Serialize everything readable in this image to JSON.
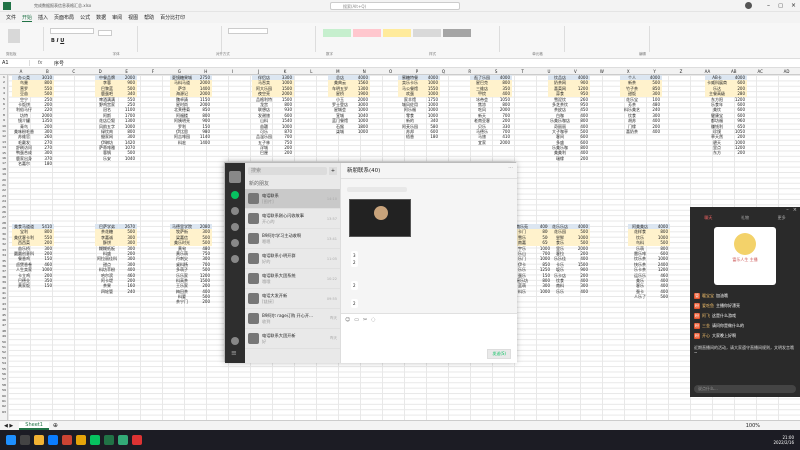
{
  "window": {
    "title": "完成数据报表信息表格汇总.xlsx",
    "search": "搜索(Alt+Q)"
  },
  "menu": [
    "文件",
    "开始",
    "插入",
    "页面布局",
    "公式",
    "数据",
    "审阅",
    "视图",
    "帮助",
    "百分比打印"
  ],
  "ribbon": {
    "groups": [
      "剪贴板",
      "字体",
      "对齐方式",
      "数字",
      "样式",
      "单元格",
      "编辑"
    ]
  },
  "formula": {
    "namebox": "A1",
    "fx": "fx",
    "content": "序号"
  },
  "columns": [
    "A",
    "B",
    "C",
    "D",
    "E",
    "F",
    "G",
    "H",
    "I",
    "J",
    "K",
    "L",
    "M",
    "N",
    "O",
    "P",
    "Q",
    "R",
    "S",
    "T",
    "U",
    "V",
    "W",
    "X",
    "Y",
    "Z",
    "AA",
    "AB",
    "AC",
    "AD"
  ],
  "tables_top": [
    {
      "title": "办公类",
      "total": "3010",
      "rows": [
        [
          "鸟巢",
          "800"
        ],
        [
          "营罗",
          "550"
        ],
        [
          "豆苗",
          "500"
        ],
        [
          "空宁",
          "250"
        ],
        [
          "卡饭饼",
          "200"
        ],
        [
          "利俗马仔",
          "220"
        ],
        [
          "坊特",
          "2000"
        ],
        [
          "镜介罐",
          "1350"
        ],
        [
          "青鸟",
          "200"
        ],
        [
          "美味粉毛香",
          "300"
        ],
        [
          "苏维官",
          "260"
        ],
        [
          "毛戴发",
          "270"
        ],
        [
          "舒刷访问",
          "270"
        ],
        [
          "鸭蛋合成",
          "300"
        ],
        [
          "鹿家出身",
          "370"
        ],
        [
          "名嘉尔",
          "180"
        ]
      ]
    },
    {
      "title": "中餐品牌",
      "total": "2000",
      "rows": [
        [
          "李蓉",
          "900"
        ],
        [
          "巴黎蓝",
          "500"
        ],
        [
          "鹿蛋吧",
          "340"
        ],
        [
          "啤酒满满",
          "550"
        ],
        [
          "野鸡宫家",
          "250"
        ],
        [
          "冠名",
          "1100"
        ],
        [
          "阿斯",
          "1700"
        ],
        [
          "花店巨叙",
          "1300"
        ],
        [
          "风韵五字",
          "1000"
        ],
        [
          "绿饮肉",
          "800"
        ],
        [
          "摄家网",
          "300"
        ],
        [
          "伊琳坊",
          "1420"
        ],
        [
          "萨蒂啡雅",
          "1070"
        ],
        [
          "蓉锅",
          "500"
        ],
        [
          "乐安",
          "1040"
        ]
      ]
    },
    {
      "title": "夏镜糖果城",
      "total": "2750",
      "rows": [
        [
          "马料马道",
          "2000"
        ],
        [
          "萨华",
          "1400"
        ],
        [
          "海源记",
          "2000"
        ],
        [
          "魏卓清",
          "1150"
        ],
        [
          "星时尚",
          "2000"
        ],
        [
          "北莱德菊",
          "850"
        ],
        [
          "阿福楼",
          "800"
        ],
        [
          "阿姨明亮",
          "900"
        ],
        [
          "罗利",
          "150"
        ],
        [
          "伊比思",
          "980"
        ],
        [
          "阿吉啡园",
          "1140"
        ],
        [
          "料宏",
          "1400"
        ]
      ]
    },
    {
      "title": "伴侣店",
      "total": "3300",
      "rows": [
        [
          "马吞卖",
          "1000"
        ],
        [
          "阿大乐园",
          "1500"
        ],
        [
          "夜空亮",
          "2000"
        ],
        [
          "品格利特",
          "1500"
        ],
        [
          "龙宫",
          "800"
        ],
        [
          "联想店",
          "930"
        ],
        [
          "发谢旅",
          "600"
        ],
        [
          "山料",
          "1540"
        ],
        [
          "苗疆",
          "1000"
        ],
        [
          "可乐",
          "870"
        ],
        [
          "品温乐园",
          "700"
        ],
        [
          "五子林",
          "750"
        ],
        [
          "浮城",
          "200"
        ],
        [
          "巴厘",
          "200"
        ]
      ]
    },
    {
      "title": "总店",
      "total": "4000",
      "rows": [
        [
          "美典云",
          "1560"
        ],
        [
          "车明五岁",
          "1300"
        ],
        [
          "星桥",
          "1900"
        ],
        [
          "小玉",
          "2000"
        ],
        [
          "罗士登店",
          "3000"
        ],
        [
          "星城会",
          "1000"
        ],
        [
          "宣城",
          "1040"
        ],
        [
          "蓝门餐馆",
          "1000"
        ],
        [
          "石猴",
          "1800"
        ],
        [
          "柒城",
          "1000"
        ]
      ]
    },
    {
      "title": "蜜糖特餐",
      "total": "4000",
      "rows": [
        [
          "卖乐卡乐",
          "1000"
        ],
        [
          "马公餐馆",
          "1550"
        ],
        [
          "欢蛋",
          "1000"
        ],
        [
          "家羊馆",
          "1750"
        ],
        [
          "城风佐用",
          "1000"
        ],
        [
          "阿乐福",
          "1000"
        ],
        [
          "零食",
          "1000"
        ],
        [
          "新的",
          "340"
        ],
        [
          "阿芙乐园",
          "580"
        ],
        [
          "苏邦",
          "600"
        ],
        [
          "梧香",
          "180"
        ]
      ]
    },
    {
      "title": "逛了乐园",
      "total": "4000",
      "rows": [
        [
          "星巴克",
          "800"
        ],
        [
          "三维店",
          "350"
        ],
        [
          "甲烷",
          "400"
        ],
        [
          "冰帝会",
          "1050"
        ],
        [
          "焦凉",
          "800"
        ],
        [
          "吃风",
          "2000"
        ],
        [
          "新天",
          "700"
        ],
        [
          "老南亚客",
          "200"
        ],
        [
          "贝乐",
          "330"
        ],
        [
          "马德乐",
          "700"
        ],
        [
          "马旅",
          "410"
        ],
        [
          "宜家",
          "2000"
        ]
      ]
    },
    {
      "title": "饮品店",
      "total": "4000",
      "rows": [
        [
          "奶茶网",
          "900"
        ],
        [
          "喜菜网",
          "1200"
        ],
        [
          "蒜食",
          "950"
        ],
        [
          "雪泥饮",
          "260"
        ],
        [
          "多芝茶饮",
          "950"
        ],
        [
          "茶皮店",
          "450"
        ],
        [
          "白咖",
          "400"
        ],
        [
          "乐美乐咖店",
          "800"
        ],
        [
          "奇丽丽",
          "400"
        ],
        [
          "大子咖亭",
          "500"
        ],
        [
          "客间",
          "600"
        ],
        [
          "多盛",
          "600"
        ],
        [
          "乐美乐咖",
          "800"
        ],
        [
          "美美利",
          "400"
        ],
        [
          "瑞缘",
          "200"
        ]
      ]
    },
    {
      "title": "个人",
      "total": "4000",
      "rows": [
        [
          "新茶",
          "500"
        ],
        [
          "竹子茶",
          "850"
        ],
        [
          "甜饭",
          "300"
        ],
        [
          "花乐宝",
          "100"
        ],
        [
          "芳茶",
          "480"
        ],
        [
          "料乐美艺",
          "240"
        ],
        [
          "饮食",
          "300"
        ],
        [
          "胡苏",
          "400"
        ],
        [
          "门缘",
          "200"
        ],
        [
          "喜奶茶",
          "400"
        ]
      ]
    },
    {
      "title": "AB卡",
      "total": "4000",
      "rows": [
        [
          "卡威科展商",
          "600"
        ],
        [
          "乐达",
          "200"
        ],
        [
          "主餐高级",
          "280"
        ],
        [
          "东方阳",
          "1200"
        ],
        [
          "乐食年",
          "600"
        ],
        [
          "美饮",
          "600"
        ],
        [
          "健康宝",
          "600"
        ],
        [
          "都坊福",
          "960"
        ],
        [
          "赚钱利",
          "650"
        ],
        [
          "珍馍",
          "1050"
        ],
        [
          "草天然",
          "200"
        ],
        [
          "碧天",
          "1000"
        ],
        [
          "里点",
          "1200"
        ],
        [
          "东方",
          "200"
        ]
      ]
    }
  ],
  "tables_bottom": [
    {
      "title": "美食马道道",
      "total": "5410",
      "rows": [
        [
          "宝利",
          "800"
        ],
        [
          "美优客卡利",
          "550"
        ],
        [
          "西西菜",
          "200"
        ],
        [
          "苗乐桥",
          "300"
        ],
        [
          "圆圆创意科",
          "200"
        ],
        [
          "餐香鸡",
          "150"
        ],
        [
          "卤煲香卷",
          "460"
        ],
        [
          "人生卖家",
          "1000"
        ],
        [
          "卡立鸡",
          "200"
        ],
        [
          "巴德业",
          "350"
        ],
        [
          "黄家饭",
          "150"
        ]
      ]
    },
    {
      "title": "巴萨学弟",
      "total": "2670",
      "rows": [
        [
          "茶花糖",
          "500"
        ],
        [
          "李嘉诚",
          "300"
        ],
        [
          "酥饼",
          "300"
        ],
        [
          "糊糊纸板",
          "300"
        ],
        [
          "料盛",
          "200"
        ],
        [
          "阿拉丽佳科",
          "300"
        ],
        [
          "甜点",
          "300"
        ],
        [
          "料坊苹粉",
          "400"
        ],
        [
          "哈尔滨",
          "460"
        ],
        [
          "阿卡堤",
          "200"
        ],
        [
          "茶果",
          "160"
        ],
        [
          "四轮管",
          "240"
        ]
      ]
    },
    {
      "title": "马德里学院",
      "total": "2080",
      "rows": [
        [
          "牧萨街",
          "300"
        ],
        [
          "梁嘉信",
          "500"
        ],
        [
          "美乐时光",
          "500"
        ],
        [
          "黄旬",
          "480"
        ],
        [
          "黄乐萌",
          "750"
        ],
        [
          "丹刺尖",
          "300"
        ],
        [
          "桌料杨",
          "700"
        ],
        [
          "多萌子",
          "500"
        ],
        [
          "乐乐家",
          "1200"
        ],
        [
          "料高茶",
          "1500"
        ],
        [
          "王乐家",
          "200"
        ],
        [
          "梅田茶",
          "400"
        ],
        [
          "料要",
          "500"
        ],
        [
          "茶宁门",
          "200"
        ]
      ]
    },
    {
      "title": "伴侣大饭店",
      "total": "2000",
      "rows": [
        [
          "龙乐",
          "800"
        ],
        [
          "料地",
          "250"
        ],
        [
          "料达",
          "200"
        ],
        [
          "宇和",
          "1000"
        ],
        [
          "料宁",
          "100"
        ],
        [
          "糖乐",
          "200"
        ],
        [
          "鸟料福",
          "500"
        ],
        [
          "吉乐",
          "200"
        ],
        [
          "乐山",
          "600"
        ]
      ]
    },
    {
      "title": "南乐苑",
      "total": "4000",
      "rows": [
        [
          "卡门",
          "800"
        ],
        [
          "雪乐",
          "500"
        ],
        [
          "南嘉",
          "650"
        ],
        [
          "宇乐",
          "1000"
        ],
        [
          "乐山",
          "700"
        ],
        [
          "乐门",
          "1000"
        ],
        [
          "伊卡",
          "850"
        ],
        [
          "乐乐",
          "1250"
        ],
        [
          "蛋乐",
          "150"
        ],
        [
          "瑶乐坊",
          "800"
        ],
        [
          "蓝萌",
          "300"
        ],
        [
          "料乐",
          "1000"
        ]
      ]
    },
    {
      "title": "花乐乐店",
      "total": "4000",
      "rows": [
        [
          "花乐园",
          "500"
        ],
        [
          "尝鲜",
          "1000"
        ],
        [
          "食乐",
          "500"
        ],
        [
          "里乐",
          "2000"
        ],
        [
          "客拉",
          "200"
        ],
        [
          "乐乐佳",
          "400"
        ],
        [
          "卡乐",
          "1500"
        ],
        [
          "坂乐",
          "900"
        ],
        [
          "乐卡店",
          "200"
        ],
        [
          "饮食",
          "400"
        ],
        [
          "南料",
          "300"
        ],
        [
          "乐乐",
          "400"
        ]
      ]
    },
    {
      "title": "阿美美店",
      "total": "4000",
      "rows": [
        [
          "花样食",
          "800"
        ],
        [
          "饮乐",
          "1000"
        ],
        [
          "鸟料",
          "500"
        ],
        [
          "乐萌",
          "800"
        ],
        [
          "雷乐啡",
          "600"
        ],
        [
          "饮乐茶",
          "1000"
        ],
        [
          "快乐茶",
          "2400"
        ],
        [
          "乐卡茶",
          "1200"
        ],
        [
          "运乐乐",
          "460"
        ],
        [
          "美乐",
          "400"
        ],
        [
          "客乐",
          "400"
        ],
        [
          "蚕卡",
          "400"
        ],
        [
          "人乐了",
          "500"
        ]
      ]
    }
  ],
  "chat": {
    "title": "新朋联系(40)",
    "search": "搜索",
    "new_friends": "新的朋友",
    "conversations": [
      {
        "name": "电话联系",
        "preview": "[图片]",
        "time": "14:10"
      },
      {
        "name": "电话联系刚心闪收故事",
        "preview": "开心的",
        "time": "13:57"
      },
      {
        "name": "B9阿尔学习主动收啊",
        "preview": "嗯嗯",
        "time": "13:41"
      },
      {
        "name": "电话联系小明开群",
        "preview": "好的",
        "time": "11:05"
      },
      {
        "name": "电话联系大团系统",
        "preview": "哦哦",
        "time": "10:22"
      },
      {
        "name": "电话大发开新",
        "preview": "[链接]",
        "time": "09:55"
      },
      {
        "name": "B9阿尔 rage订购 开心开...",
        "preview": "收到",
        "time": "昨天"
      },
      {
        "name": "电话联系大团开新",
        "preview": "好",
        "time": "昨天"
      }
    ],
    "messages": [
      "2",
      "2",
      "2",
      "3"
    ],
    "send": "发送(S)"
  },
  "live": {
    "tabs": [
      "聊天",
      "礼物",
      "更多"
    ],
    "banner": "富乐人生 主播",
    "comments": [
      {
        "tag": "管",
        "user": "暖宝宝",
        "text": "加油哦"
      },
      {
        "tag": "粉",
        "user": "爱吃鱼",
        "text": "主播你好漂亮"
      },
      {
        "tag": "粉",
        "user": "阿飞",
        "text": "这是什么游戏"
      },
      {
        "tag": "粉",
        "user": "三金",
        "text": "请问你是做什么的"
      },
      {
        "tag": "粉",
        "user": "开心",
        "text": "大家晚上好啊"
      }
    ],
    "notice": "近期直播间的活动，请大家遵守直播间规则，文明发言哦~",
    "input": "说点什么..."
  },
  "sheet": {
    "tab": "Sheet1",
    "status": "就绪",
    "zoom": "100%"
  },
  "taskbar": {
    "time": "21:00",
    "date": "2022/2/16"
  }
}
